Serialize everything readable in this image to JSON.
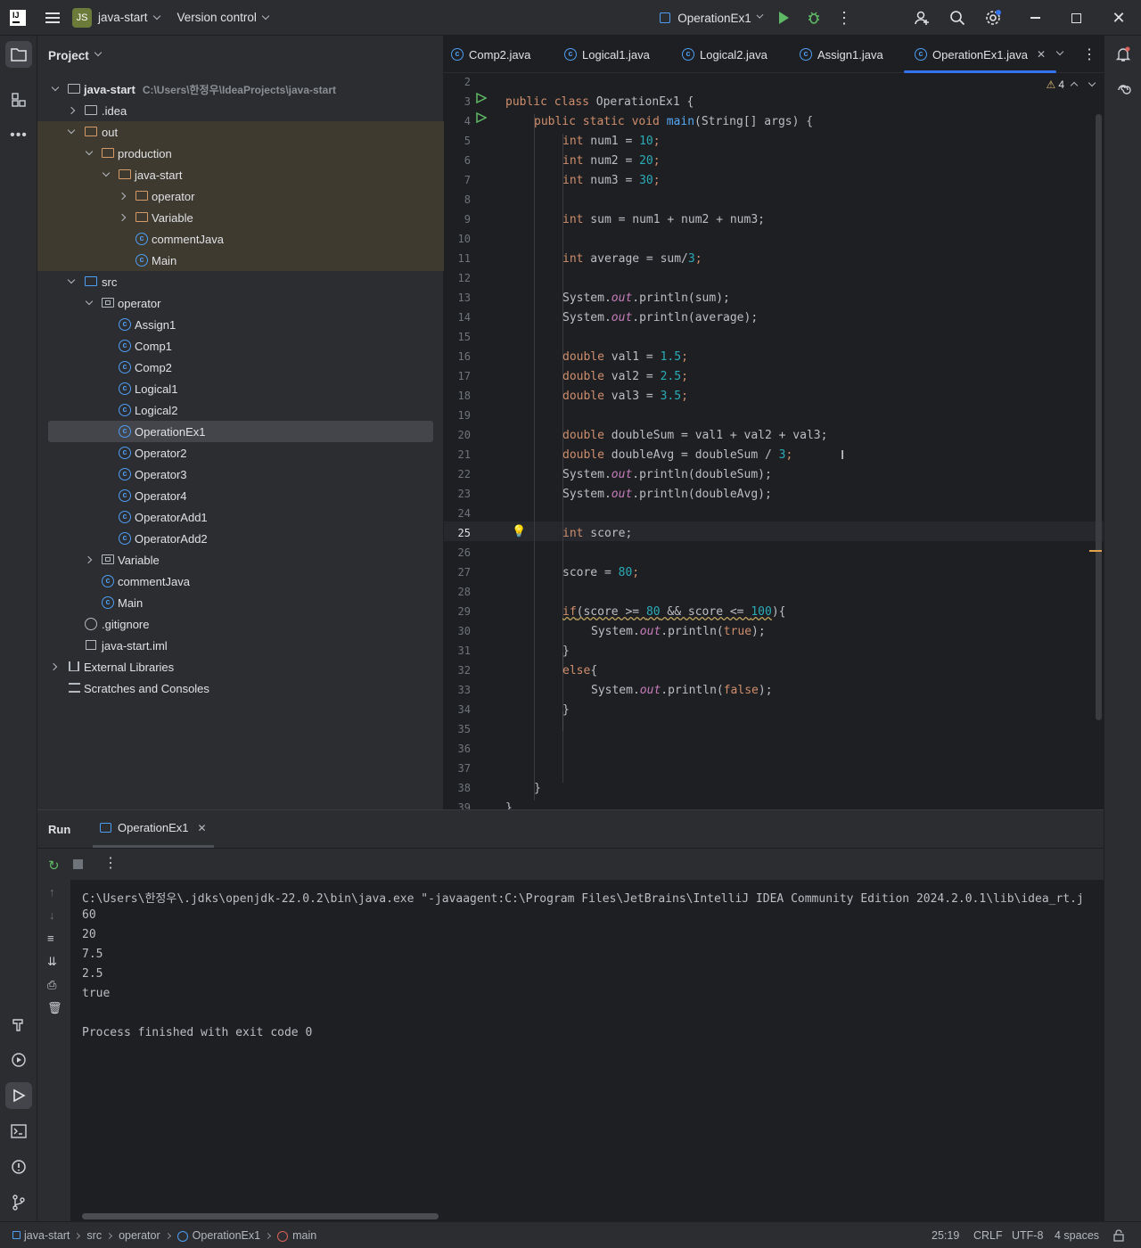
{
  "topbar": {
    "project_badge": "JS",
    "project_name": "java-start",
    "vcs": "Version control",
    "run_config": "OperationEx1"
  },
  "project_panel": {
    "title": "Project",
    "root_name": "java-start",
    "root_path": "C:\\Users\\한정우\\IdeaProjects\\java-start",
    "items": [
      {
        "label": ".idea"
      },
      {
        "label": "out"
      },
      {
        "label": "production"
      },
      {
        "label": "java-start"
      },
      {
        "label": "operator"
      },
      {
        "label": "Variable"
      },
      {
        "label": "commentJava"
      },
      {
        "label": "Main"
      },
      {
        "label": "src"
      },
      {
        "label": "operator"
      },
      {
        "label": "Assign1"
      },
      {
        "label": "Comp1"
      },
      {
        "label": "Comp2"
      },
      {
        "label": "Logical1"
      },
      {
        "label": "Logical2"
      },
      {
        "label": "OperationEx1"
      },
      {
        "label": "Operator2"
      },
      {
        "label": "Operator3"
      },
      {
        "label": "Operator4"
      },
      {
        "label": "OperatorAdd1"
      },
      {
        "label": "OperatorAdd2"
      },
      {
        "label": "Variable"
      },
      {
        "label": "commentJava"
      },
      {
        "label": "Main"
      },
      {
        "label": ".gitignore"
      },
      {
        "label": "java-start.iml"
      },
      {
        "label": "External Libraries"
      },
      {
        "label": "Scratches and Consoles"
      }
    ]
  },
  "editor": {
    "tabs": [
      {
        "label": "Comp2.java"
      },
      {
        "label": "Logical1.java"
      },
      {
        "label": "Logical2.java"
      },
      {
        "label": "Assign1.java"
      },
      {
        "label": "OperationEx1.java"
      }
    ],
    "warnings": "4",
    "line_numbers": [
      "2",
      "3",
      "4",
      "5",
      "6",
      "7",
      "8",
      "9",
      "10",
      "11",
      "12",
      "13",
      "14",
      "15",
      "16",
      "17",
      "18",
      "19",
      "20",
      "21",
      "22",
      "23",
      "24",
      "25",
      "26",
      "27",
      "28",
      "29",
      "30",
      "31",
      "32",
      "33",
      "34",
      "35",
      "36",
      "37",
      "38",
      "39"
    ],
    "code": {
      "l3a": "public class ",
      "l3b": "OperationEx1 {",
      "l4a": "public static void ",
      "l4b": "main",
      "l4c": "(String[] args) {",
      "int": "int",
      "double": "double",
      "l5": " num1 = ",
      "l5n": "10",
      "semi": ";",
      "l6": " num2 = ",
      "l6n": "20",
      "l7": " num3 = ",
      "l7n": "30",
      "l9": " sum = num1 + num2 + num3;",
      "l11": " average = sum/",
      "l11n": "3",
      "sys": "System.",
      "out": "out",
      "println_sum": ".println(sum);",
      "println_avg": ".println(average);",
      "l16": " val1 = ",
      "l16n": "1.5",
      "l17": " val2 = ",
      "l17n": "2.5",
      "l18": " val3 = ",
      "l18n": "3.5",
      "l20": " doubleSum = val1 + val2 + val3;",
      "l21": " doubleAvg = doubleSum / ",
      "l21n": "3",
      "println_dsum": ".println(doubleSum);",
      "println_davg": ".println(doubleAvg);",
      "l25": " score;",
      "l27": "score = ",
      "l27n": "80",
      "if": "if",
      "l29a": "(score >= ",
      "l29n1": "80",
      "l29b": " && score <= ",
      "l29n2": "100",
      "l29c": "){",
      "println_pre": ".println(",
      "true": "true",
      "false": "false",
      "close_paren": ");",
      "brace": "}",
      "else": "else",
      "open_brace": "{"
    }
  },
  "run_panel": {
    "title": "Run",
    "tab": "OperationEx1",
    "output": [
      "C:\\Users\\한정우\\.jdks\\openjdk-22.0.2\\bin\\java.exe \"-javaagent:C:\\Program Files\\JetBrains\\IntelliJ IDEA Community Edition 2024.2.0.1\\lib\\idea_rt.j",
      "60",
      "20",
      "7.5",
      "2.5",
      "true",
      "",
      "Process finished with exit code 0"
    ]
  },
  "statusbar": {
    "crumbs": [
      "java-start",
      "src",
      "operator",
      "OperationEx1",
      "main"
    ],
    "position": "25:19",
    "line_sep": "CRLF",
    "encoding": "UTF-8",
    "indent": "4 spaces"
  },
  "colors": {
    "accent": "#3574f0",
    "run_green": "#5fb865",
    "debug_green": "#5fb865",
    "class_icon": "#4e9ef3"
  }
}
